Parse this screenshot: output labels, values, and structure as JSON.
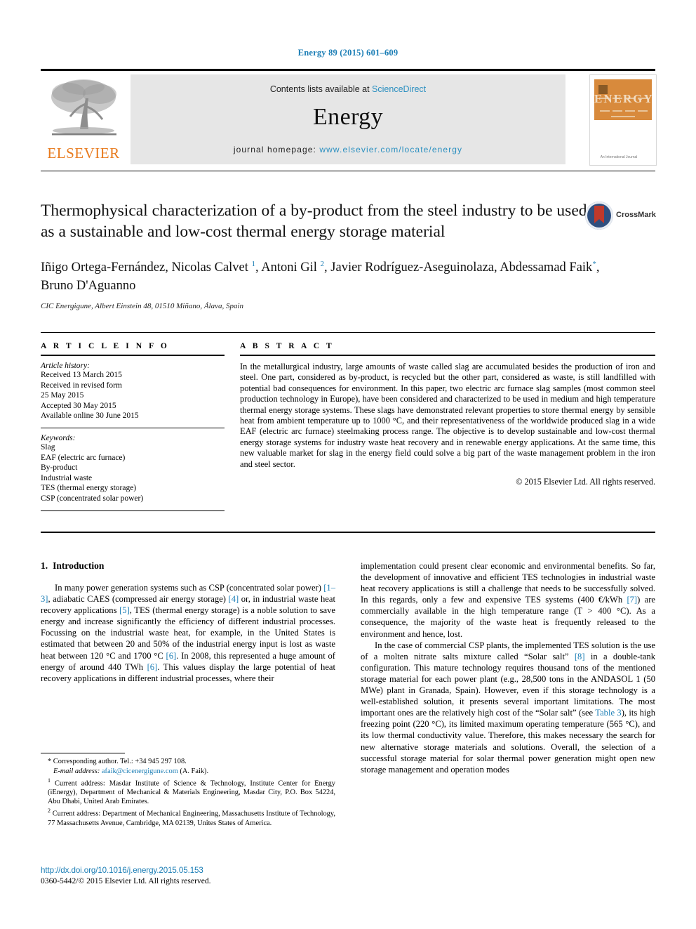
{
  "running_head": "Energy 89 (2015) 601–609",
  "masthead": {
    "contents_prefix": "Contents lists available at ",
    "sciencedirect": "ScienceDirect",
    "journal_title": "Energy",
    "homepage_prefix": "journal homepage: ",
    "homepage_url": "www.elsevier.com/locate/energy",
    "publisher_wordmark": "ELSEVIER",
    "cover_wordmark": "ENERGY",
    "cover_footer": "An International Journal"
  },
  "article": {
    "title": "Thermophysical characterization of a by-product from the steel industry to be used as a sustainable and low-cost thermal energy storage material",
    "crossmark_label": "CrossMark",
    "authors_line1_part1": "Iñigo Ortega-Fernández, Nicolas Calvet ",
    "authors_sup1": "1",
    "authors_line1_part2": ", Antoni Gil ",
    "authors_sup2": "2",
    "authors_line1_part3": ", Javier Rodríguez-Aseguinolaza,",
    "authors_line2_part1": "Abdessamad Faik",
    "authors_sup_star": "*",
    "authors_line2_part2": ", Bruno D'Aguanno",
    "affiliation": "CIC Energigune, Albert Einstein 48, 01510 Miñano, Álava, Spain"
  },
  "article_info": {
    "heading": "A R T I C L E   I N F O",
    "history_label": "Article history:",
    "history": [
      "Received 13 March 2015",
      "Received in revised form",
      "25 May 2015",
      "Accepted 30 May 2015",
      "Available online 30 June 2015"
    ],
    "keywords_label": "Keywords:",
    "keywords": [
      "Slag",
      "EAF (electric arc furnace)",
      "By-product",
      "Industrial waste",
      "TES (thermal energy storage)",
      "CSP (concentrated solar power)"
    ]
  },
  "abstract": {
    "heading": "A B S T R A C T",
    "text": "In the metallurgical industry, large amounts of waste called slag are accumulated besides the production of iron and steel. One part, considered as by-product, is recycled but the other part, considered as waste, is still landfilled with potential bad consequences for environment. In this paper, two electric arc furnace slag samples (most common steel production technology in Europe), have been considered and characterized to be used in medium and high temperature thermal energy storage systems. These slags have demonstrated relevant properties to store thermal energy by sensible heat from ambient temperature up to 1000 °C, and their representativeness of the worldwide produced slag in a wide EAF (electric arc furnace) steelmaking process range. The objective is to develop sustainable and low-cost thermal energy storage systems for industry waste heat recovery and in renewable energy applications. At the same time, this new valuable market for slag in the energy field could solve a big part of the waste management problem in the iron and steel sector.",
    "copyright": "© 2015 Elsevier Ltd. All rights reserved."
  },
  "introduction": {
    "number": "1.",
    "title": "Introduction",
    "left_p1_a": "In many power generation systems such as CSP (concentrated solar power) ",
    "left_ref1": "[1–3]",
    "left_p1_b": ", adiabatic CAES (compressed air energy storage) ",
    "left_ref2": "[4]",
    "left_p1_c": " or, in industrial waste heat recovery applications ",
    "left_ref3": "[5]",
    "left_p1_d": ", TES (thermal energy storage) is a noble solution to save energy and increase significantly the efficiency of different industrial processes. Focussing on the industrial waste heat, for example, in the United States is estimated that between 20 and 50% of the industrial energy input is lost as waste heat between 120 °C and 1700 °C ",
    "left_ref4": "[6]",
    "left_p1_e": ". In 2008, this represented a huge amount of energy of around 440 TWh ",
    "left_ref5": "[6]",
    "left_p1_f": ". This values display the large potential of heat recovery applications in different industrial processes, where their",
    "right_p1_a": "implementation could present clear economic and environmental benefits. So far, the development of innovative and efficient TES technologies in industrial waste heat recovery applications is still a challenge that needs to be successfully solved. In this regards, only a few and expensive TES systems (400 €/kWh ",
    "right_ref1": "[7]",
    "right_p1_b": ") are commercially available in the high temperature range (T > 400 °C). As a consequence, the majority of the waste heat is frequently released to the environment and hence, lost.",
    "right_p2_a": "In the case of commercial CSP plants, the implemented TES solution is the use of a molten nitrate salts mixture called “Solar salt” ",
    "right_ref2": "[8]",
    "right_p2_b": " in a double-tank configuration. This mature technology requires thousand tons of the mentioned storage material for each power plant (e.g., 28,500 tons in the ANDASOL 1 (50 MWe) plant in Granada, Spain). However, even if this storage technology is a well-established solution, it presents several important limitations. The most important ones are the relatively high cost of the “Solar salt” (see ",
    "right_ref3": "Table 3",
    "right_p2_c": "), its high freezing point (220 °C), its limited maximum operating temperature (565 °C), and its low thermal conductivity value. Therefore, this makes necessary the search for new alternative storage materials and solutions. Overall, the selection of a successful storage material for solar thermal power generation might open new storage management and operation modes"
  },
  "footnotes": {
    "star_mark": "*",
    "star_text": " Corresponding author. Tel.: +34 945 297 108.",
    "email_label": "E-mail address:",
    "email": "afaik@cicenergigune.com",
    "email_suffix": " (A. Faik).",
    "fn1_mark": "1",
    "fn1_text": " Current address: Masdar Institute of Science & Technology, Institute Center for Energy (iEnergy), Department of Mechanical & Materials Engineering, Masdar City, P.O. Box 54224, Abu Dhabi, United Arab Emirates.",
    "fn2_mark": "2",
    "fn2_text": " Current address: Department of Mechanical Engineering, Massachusetts Institute of Technology, 77 Massachusetts Avenue, Cambridge, MA 02139, Unites States of America."
  },
  "doi_block": {
    "doi": "http://dx.doi.org/10.1016/j.energy.2015.05.153",
    "issn": "0360-5442/© 2015 Elsevier Ltd. All rights reserved."
  }
}
